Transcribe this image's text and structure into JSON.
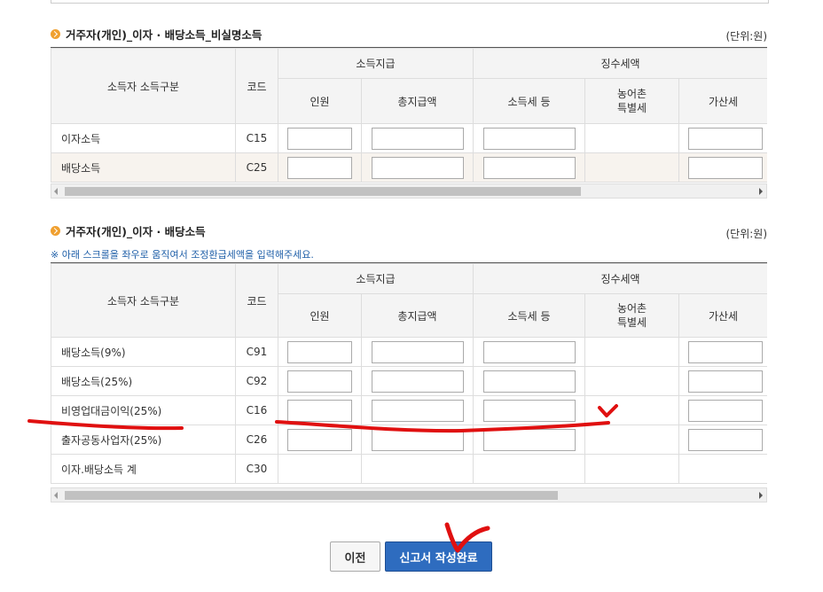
{
  "section1": {
    "title": "거주자(개인)_이자 · 배당소득_비실명소득",
    "unit": "(단위:원)",
    "headers": {
      "category": "소득자 소득구분",
      "code": "코드",
      "payment": "소득지급",
      "withholding": "징수세액",
      "persons": "인원",
      "total": "총지급액",
      "income_tax": "소득세 등",
      "rural_tax": "농어촌\n특별세",
      "penalty": "가산세"
    },
    "rows": [
      {
        "label": "이자소득",
        "code": "C15"
      },
      {
        "label": "배당소득",
        "code": "C25"
      }
    ]
  },
  "section2": {
    "title": "거주자(개인)_이자 · 배당소득",
    "unit": "(단위:원)",
    "notice": "※ 아래 스크롤을 좌우로 움직여서 조정환급세액을 입력해주세요.",
    "headers": {
      "category": "소득자 소득구분",
      "code": "코드",
      "payment": "소득지급",
      "withholding": "징수세액",
      "persons": "인원",
      "total": "총지급액",
      "income_tax": "소득세 등",
      "rural_tax": "농어촌\n특별세",
      "penalty": "가산세"
    },
    "rows": [
      {
        "label": "배당소득(9%)",
        "code": "C91"
      },
      {
        "label": "배당소득(25%)",
        "code": "C92"
      },
      {
        "label": "비영업대금이익(25%)",
        "code": "C16"
      },
      {
        "label": "출자공동사업자(25%)",
        "code": "C26"
      },
      {
        "label": "이자.배당소득 계",
        "code": "C30"
      }
    ]
  },
  "buttons": {
    "prev": "이전",
    "complete": "신고서 작성완료"
  },
  "colors": {
    "accent_blue": "#2e6cbf",
    "annotation_red": "#e01010",
    "bullet_orange": "#f0a030"
  }
}
